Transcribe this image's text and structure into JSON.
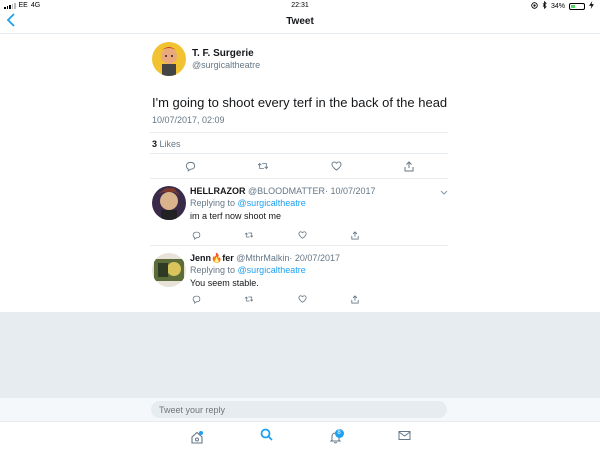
{
  "status_bar": {
    "carrier": "EE",
    "network": "4G",
    "time": "22:31",
    "battery": "34%",
    "battery_level": 0.34
  },
  "nav": {
    "title": "Tweet"
  },
  "main_tweet": {
    "name": "T. F. Surgerie",
    "handle": "@surgicaltheatre",
    "text": "I'm going to shoot every terf in the back of the head",
    "timestamp": "10/07/2017, 02:09",
    "likes_count": "3",
    "likes_label": "Likes"
  },
  "replies": [
    {
      "name": "HELLRAZOR",
      "handle": "@BLOODMATTER",
      "date": "· 10/07/2017",
      "replying_prefix": "Replying to",
      "replying_to": "@surgicaltheatre",
      "text": "im a terf now shoot me"
    },
    {
      "name_part1": "Jenn",
      "emoji": "🔥",
      "name_part2": "fer",
      "handle": "@MthrMalkin",
      "date": "· 20/07/2017",
      "replying_prefix": "Replying to",
      "replying_to": "@surgicaltheatre",
      "text": "You seem stable."
    }
  ],
  "compose": {
    "placeholder": "Tweet your reply"
  },
  "tabbar": {
    "notifications_badge": "8"
  },
  "colors": {
    "accent": "#1da1f2",
    "secondary_text": "#657786",
    "divider": "#e6ecf0",
    "like_red": "#e0245e"
  },
  "icons": [
    "back-icon",
    "reply-icon",
    "retweet-icon",
    "like-icon",
    "share-icon",
    "chevron-down-icon",
    "home-icon",
    "search-icon",
    "notifications-icon",
    "messages-icon"
  ]
}
